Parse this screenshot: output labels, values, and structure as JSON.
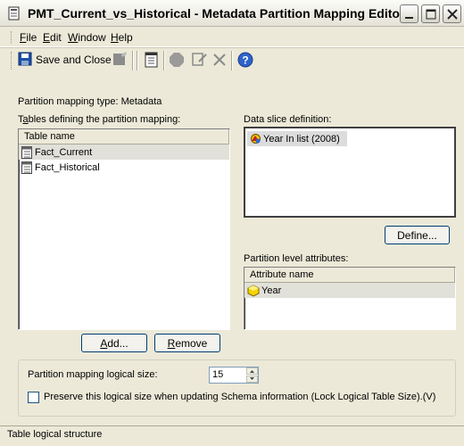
{
  "window": {
    "title": "PMT_Current_vs_Historical - Metadata Partition Mapping  Editor"
  },
  "menu": {
    "items": [
      {
        "label": "File",
        "underline": "F",
        "rest": "ile"
      },
      {
        "label": "Edit",
        "underline": "E",
        "rest": "dit"
      },
      {
        "label": "Window",
        "underline": "W",
        "rest": "indow"
      },
      {
        "label": "Help",
        "underline": "H",
        "rest": "elp"
      }
    ]
  },
  "toolbar": {
    "save_label": "Save and Close",
    "icons": [
      "save-icon",
      "edit-disabled-icon",
      "properties-icon",
      "stop-icon",
      "modify-icon",
      "delete-icon",
      "help-icon"
    ]
  },
  "partition": {
    "mapping_type_label": "Partition mapping type: Metadata",
    "tables_label_pre": "T",
    "tables_label_u": "a",
    "tables_label_post": "bles defining the partition mapping:",
    "tables_column_header": "Table name",
    "tables": [
      "Fact_Current",
      "Fact_Historical"
    ],
    "data_slice_label": "Data slice definition:",
    "data_slice_items": [
      "Year In list (2008)"
    ],
    "define_button": "Define...",
    "attributes_label": "Partition level attributes:",
    "attributes_column_header": "Attribute name",
    "attributes": [
      "Year"
    ],
    "add_button": "Add...",
    "remove_button": "Remove",
    "logical_size_label": "Partition mapping logical size:",
    "logical_size_value": "15",
    "preserve_label": "Preserve this logical size when updating Schema information (Lock Logical Table Size).(V)",
    "preserve_checked": false
  },
  "status": {
    "text": "Table logical structure"
  }
}
